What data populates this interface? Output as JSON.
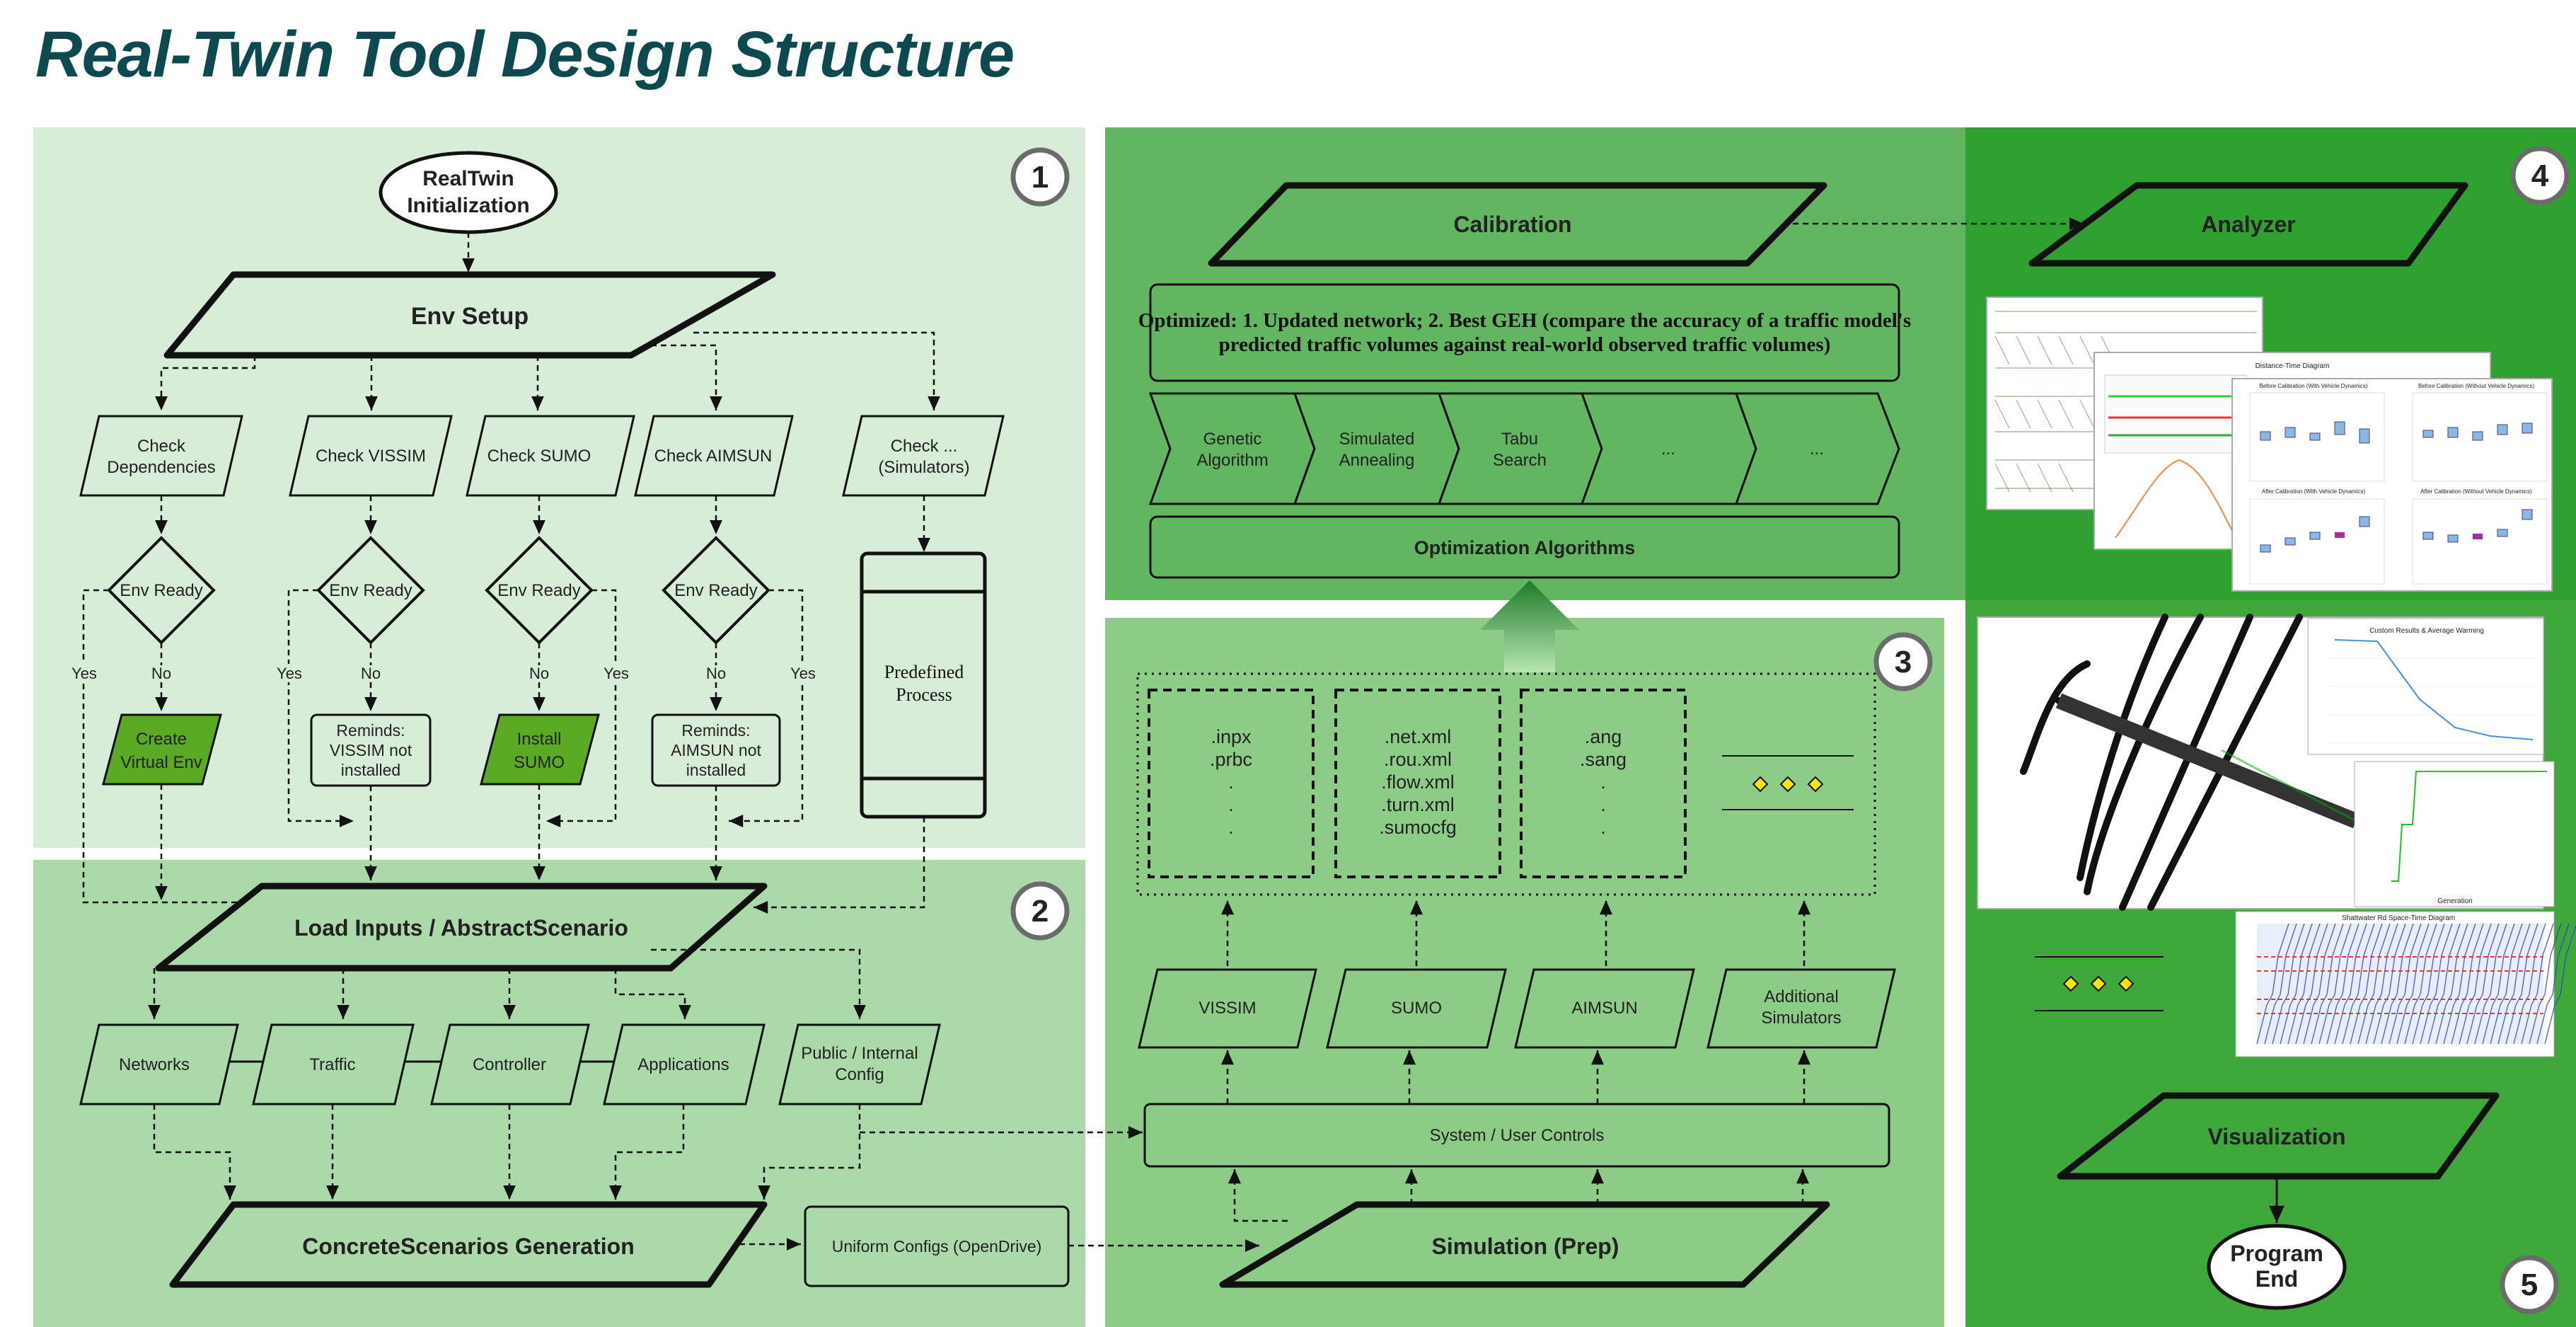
{
  "title": "Real-Twin Tool Design Structure",
  "colors": {
    "panel1": "#d8edd7",
    "panel2": "#acd9a9",
    "panel3": "#8ccc86",
    "panel_calib": "#62b561",
    "panel4": "#2ea131",
    "panel5": "#3ea83a",
    "title": "#0c4a4f",
    "highlight_green": "#5aaa23",
    "diamond_marker": "#ffe600"
  },
  "badges": {
    "b1": "1",
    "b2": "2",
    "b3": "3",
    "b4": "4",
    "b5": "5"
  },
  "panel1": {
    "start_l1": "RealTwin",
    "start_l2": "Initialization",
    "env_setup": "Env Setup",
    "checks": [
      {
        "l1": "Check",
        "l2": "Dependencies"
      },
      {
        "l1": "Check VISSIM",
        "l2": ""
      },
      {
        "l1": "Check SUMO",
        "l2": ""
      },
      {
        "l1": "Check AIMSUN",
        "l2": ""
      },
      {
        "l1": "Check ...",
        "l2": "(Simulators)"
      }
    ],
    "env_ready": "Env Ready",
    "yes": "Yes",
    "no": "No",
    "results": [
      {
        "l1": "Create",
        "l2": "Virtual Env",
        "l3": ""
      },
      {
        "l1": "Reminds:",
        "l2": "VISSIM not",
        "l3": "installed"
      },
      {
        "l1": "Install",
        "l2": "SUMO",
        "l3": ""
      },
      {
        "l1": "Reminds:",
        "l2": "AIMSUN not",
        "l3": "installed"
      }
    ],
    "predefined_l1": "Predefined",
    "predefined_l2": "Process"
  },
  "panel2": {
    "load_inputs": "Load Inputs / AbstractScenario",
    "inputs": [
      {
        "l1": "Networks",
        "l2": ""
      },
      {
        "l1": "Traffic",
        "l2": ""
      },
      {
        "l1": "Controller",
        "l2": ""
      },
      {
        "l1": "Applications",
        "l2": ""
      },
      {
        "l1": "Public / Internal",
        "l2": "Config"
      }
    ],
    "concrete": "ConcreteScenarios Generation",
    "uniform": "Uniform Configs (OpenDrive)"
  },
  "calibration": {
    "title": "Calibration",
    "optimized_l1": "Optimized: 1. Updated network; 2. Best GEH (compare the accuracy of a traffic model's",
    "optimized_l2": "predicted traffic volumes against real-world observed traffic volumes)",
    "algorithms": [
      {
        "l1": "Genetic",
        "l2": "Algorithm"
      },
      {
        "l1": "Simulated",
        "l2": "Annealing"
      },
      {
        "l1": "Tabu",
        "l2": "Search"
      },
      {
        "l1": "...",
        "l2": ""
      },
      {
        "l1": "...",
        "l2": ""
      }
    ],
    "opt_label": "Optimization Algorithms"
  },
  "panel3": {
    "files": [
      {
        "lines": [
          ".inpx",
          ".prbc",
          ".",
          ".",
          "."
        ]
      },
      {
        "lines": [
          ".net.xml",
          ".rou.xml",
          ".flow.xml",
          ".turn.xml",
          ".sumocfg"
        ]
      },
      {
        "lines": [
          ".ang",
          ".sang",
          ".",
          ".",
          "."
        ]
      }
    ],
    "sims": [
      {
        "l1": "VISSIM",
        "l2": ""
      },
      {
        "l1": "SUMO",
        "l2": ""
      },
      {
        "l1": "AIMSUN",
        "l2": ""
      },
      {
        "l1": "Additional",
        "l2": "Simulators"
      }
    ],
    "controls": "System / User Controls",
    "simulation": "Simulation (Prep)"
  },
  "panel4": {
    "analyzer": "Analyzer",
    "chart_texts": {
      "distance_time": "Distance-Time Diagram",
      "before_with": "Before Calibration (With Vehicle Dynamics)",
      "before_without": "Before Calibration (Without Vehicle Dynamics)",
      "after_with": "After Calibration (With Vehicle Dynamics)",
      "after_without": "After Calibration (Without Vehicle Dynamics)"
    }
  },
  "panel5": {
    "cost_title": "Custom Results & Average Warming",
    "generation": "Generation",
    "spacetime_title": "Shattwater Rd Space-Time Diagram",
    "visualization": "Visualization",
    "end_l1": "Program",
    "end_l2": "End"
  }
}
